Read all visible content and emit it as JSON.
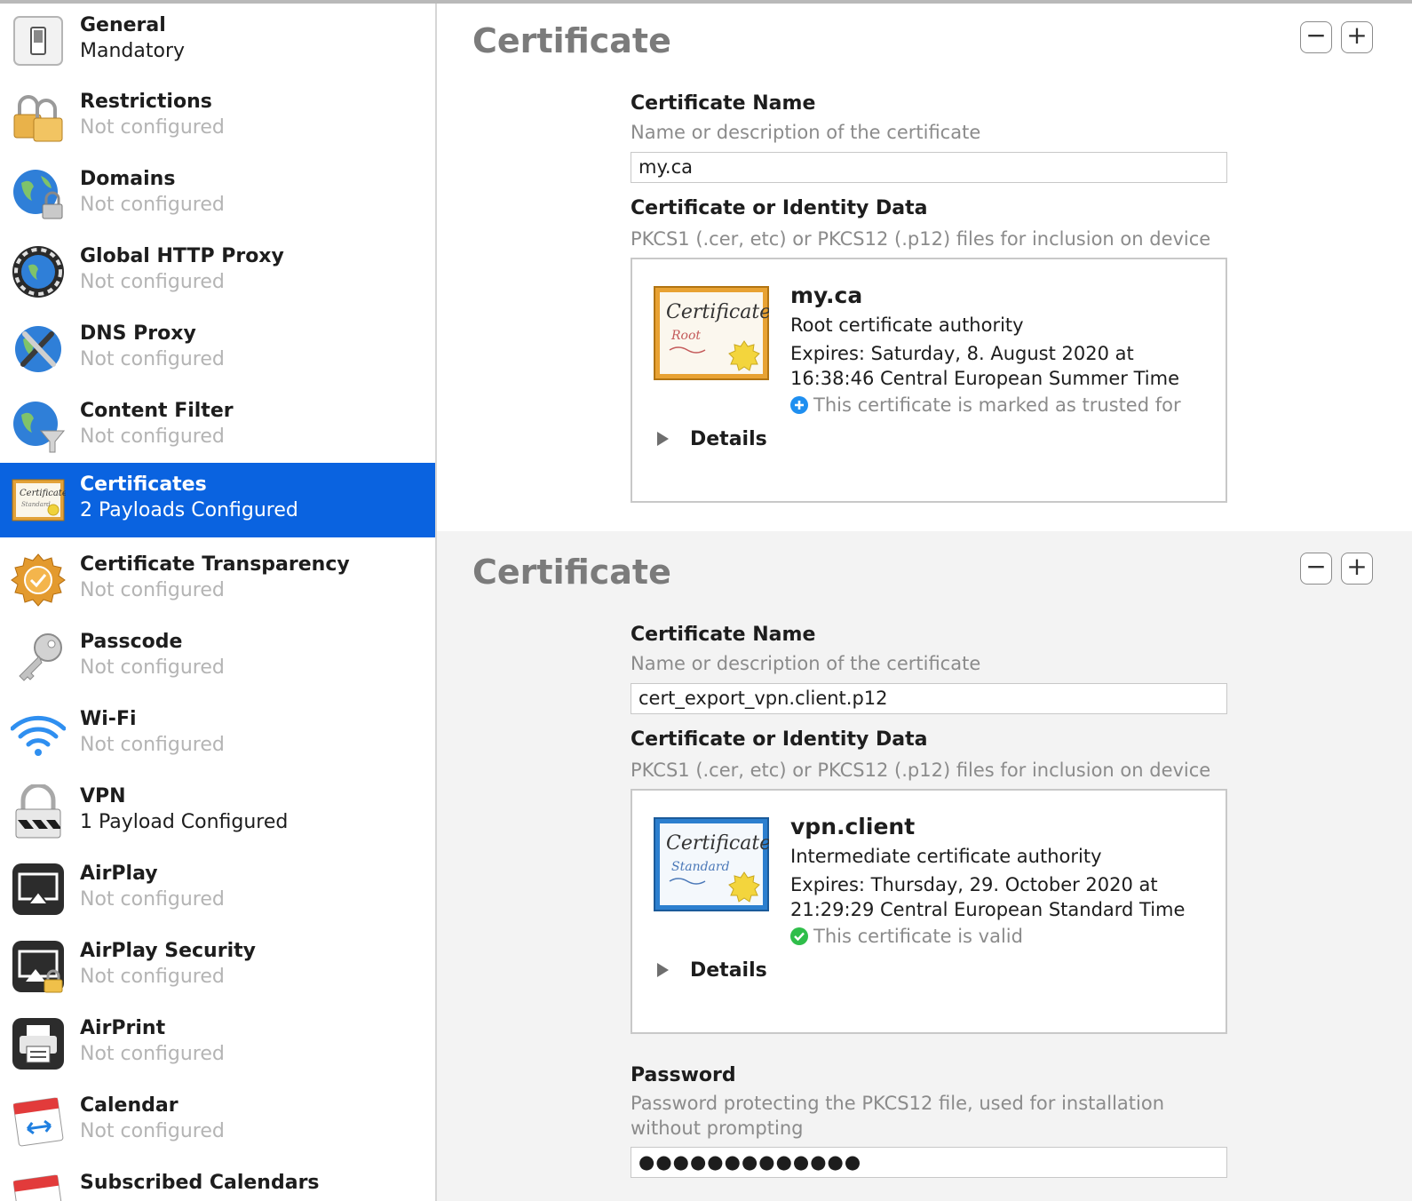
{
  "sidebar": {
    "items": [
      {
        "title": "General",
        "subtitle": "Mandatory",
        "icon": "general-switch-icon"
      },
      {
        "title": "Restrictions",
        "subtitle": "Not configured",
        "icon": "padlocks-icon"
      },
      {
        "title": "Domains",
        "subtitle": "Not configured",
        "icon": "globe-lock-icon"
      },
      {
        "title": "Global HTTP Proxy",
        "subtitle": "Not configured",
        "icon": "globe-proxy-icon"
      },
      {
        "title": "DNS Proxy",
        "subtitle": "Not configured",
        "icon": "globe-tools-icon"
      },
      {
        "title": "Content Filter",
        "subtitle": "Not configured",
        "icon": "globe-filter-icon"
      },
      {
        "title": "Certificates",
        "subtitle": "2 Payloads Configured",
        "icon": "certificate-icon"
      },
      {
        "title": "Certificate Transparency",
        "subtitle": "Not configured",
        "icon": "badge-check-icon"
      },
      {
        "title": "Passcode",
        "subtitle": "Not configured",
        "icon": "key-icon"
      },
      {
        "title": "Wi-Fi",
        "subtitle": "Not configured",
        "icon": "wifi-icon"
      },
      {
        "title": "VPN",
        "subtitle": "1 Payload Configured",
        "icon": "vpn-lock-icon"
      },
      {
        "title": "AirPlay",
        "subtitle": "Not configured",
        "icon": "airplay-icon"
      },
      {
        "title": "AirPlay Security",
        "subtitle": "Not configured",
        "icon": "airplay-security-icon"
      },
      {
        "title": "AirPrint",
        "subtitle": "Not configured",
        "icon": "printer-icon"
      },
      {
        "title": "Calendar",
        "subtitle": "Not configured",
        "icon": "calendar-icon"
      },
      {
        "title": "Subscribed Calendars",
        "subtitle": "",
        "icon": "subscribed-calendar-icon"
      }
    ]
  },
  "payloads": [
    {
      "title": "Certificate",
      "remove_label": "−",
      "add_label": "+",
      "name_label": "Certificate Name",
      "name_desc": "Name or description of the certificate",
      "name_value": "my.ca",
      "data_label": "Certificate or Identity Data",
      "data_desc": "PKCS1 (.cer, etc) or PKCS12 (.p12) files for inclusion on device",
      "cert": {
        "name": "my.ca",
        "kind": "Root certificate authority",
        "expires": "Expires: Saturday, 8. August 2020 at 16:38:46 Central European Summer Time",
        "status": "This certificate is marked as trusted for",
        "status_icon": "plus-circle-icon",
        "image_text": "Certificate",
        "image_subtext": "Root",
        "details_label": "Details"
      }
    },
    {
      "title": "Certificate",
      "remove_label": "−",
      "add_label": "+",
      "name_label": "Certificate Name",
      "name_desc": "Name or description of the certificate",
      "name_value": "cert_export_vpn.client.p12",
      "data_label": "Certificate or Identity Data",
      "data_desc": "PKCS1 (.cer, etc) or PKCS12 (.p12) files for inclusion on device",
      "cert": {
        "name": "vpn.client",
        "kind": "Intermediate certificate authority",
        "expires": "Expires: Thursday, 29. October 2020 at 21:29:29 Central European Standard Time",
        "status": "This certificate is valid",
        "status_icon": "checkmark-circle-icon",
        "image_text": "Certificate",
        "image_subtext": "Standard",
        "details_label": "Details"
      },
      "password_label": "Password",
      "password_desc": "Password protecting the PKCS12 file, used for installation without prompting",
      "password_value": "●●●●●●●●●●●●●"
    }
  ],
  "colors": {
    "selection": "#0a63e0",
    "trusted_blue": "#1f8ff0",
    "valid_green": "#2fbe4a"
  }
}
